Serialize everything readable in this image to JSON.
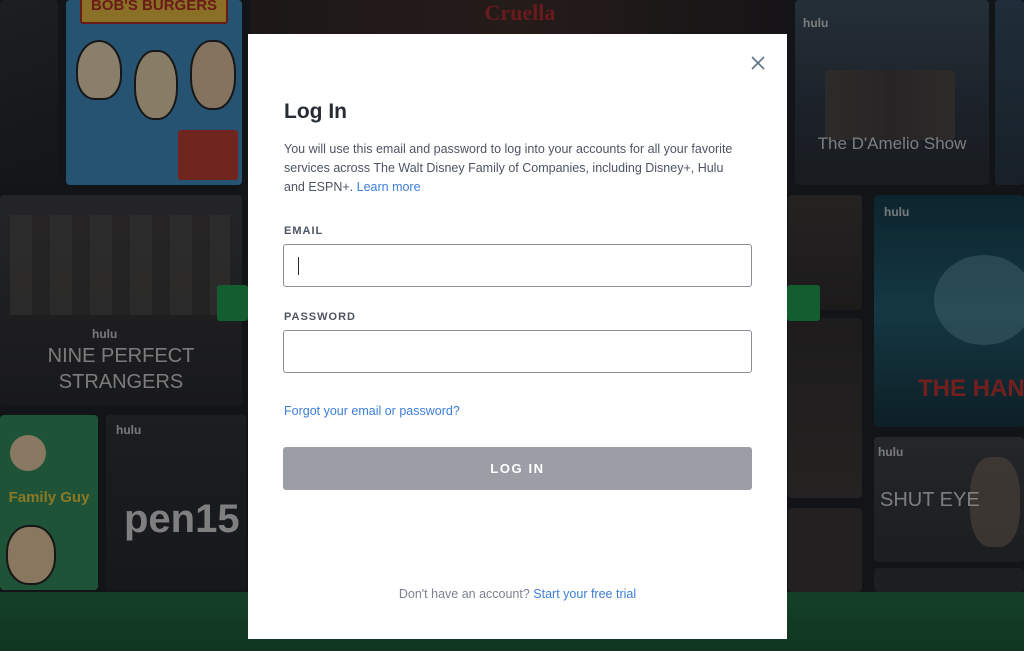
{
  "background": {
    "tiles": [
      {
        "title": "BOB'S BURGERS"
      },
      {
        "title": "Cruella"
      },
      {
        "title": "The D'Amelio Show",
        "network": "hulu"
      },
      {
        "title": "NINE PERFECT STRANGERS",
        "network": "hulu"
      },
      {
        "title": "Family Guy"
      },
      {
        "title": "pen15",
        "network": "hulu"
      },
      {
        "title": "THE HAND",
        "network": "hulu"
      },
      {
        "title": "SHUT EYE",
        "network": "hulu"
      }
    ],
    "colors": {
      "band": "#1d6b3c",
      "button": "#1ca04f"
    }
  },
  "modal": {
    "close_icon": "close-icon",
    "title": "Log In",
    "description": "You will use this email and password to log into your accounts for all your favorite services across The Walt Disney Family of Companies, including Disney+, Hulu and ESPN+.",
    "learn_more": "Learn more",
    "email_label": "EMAIL",
    "email_value": "",
    "password_label": "PASSWORD",
    "password_value": "",
    "forgot_link": "Forgot your email or password?",
    "login_button": "LOG IN",
    "footer_text": "Don't have an account?",
    "footer_link": "Start your free trial",
    "colors": {
      "link": "#3d7ed8",
      "button_disabled": "#9b9ea4",
      "title": "#272c34"
    }
  }
}
